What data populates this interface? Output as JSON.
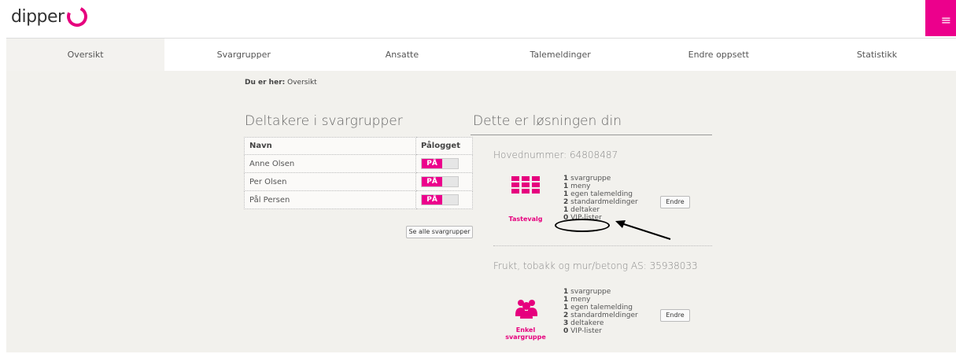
{
  "brand": {
    "name": "dipper",
    "accent": "#ec008c"
  },
  "header": {
    "menu_icon": "hamburger-icon"
  },
  "nav": {
    "tabs": [
      "Oversikt",
      "Svargrupper",
      "Ansatte",
      "Talemeldinger",
      "Endre oppsett",
      "Statistikk"
    ]
  },
  "breadcrumb": {
    "prefix": "Du er her:",
    "current": "Oversikt"
  },
  "members": {
    "title": "Deltakere i svargrupper",
    "columns": [
      "Navn",
      "Pålogget"
    ],
    "rows": [
      {
        "name": "Anne Olsen",
        "status": "PÅ"
      },
      {
        "name": "Per Olsen",
        "status": "PÅ"
      },
      {
        "name": "Pål Persen",
        "status": "PÅ"
      }
    ],
    "see_all_label": "Se alle svargrupper"
  },
  "solution": {
    "title": "Dette er løsningen din",
    "blocks": [
      {
        "title": "Hovednummer: 64808487",
        "icon_label": "Tastevalg",
        "icon": "keypad-icon",
        "lines": [
          {
            "count": "1",
            "label": "svargruppe"
          },
          {
            "count": "1",
            "label": "meny"
          },
          {
            "count": "1",
            "label": "egen talemelding"
          },
          {
            "count": "2",
            "label": "standardmeldinger"
          },
          {
            "count": "1",
            "label": "deltaker"
          },
          {
            "count": "0",
            "label": "VIP-lister"
          }
        ],
        "edit_label": "Endre"
      },
      {
        "title": "Frukt, tobakk og mur/betong AS: 35938033",
        "icon_label": "Enkel svargruppe",
        "icon": "group-icon",
        "lines": [
          {
            "count": "1",
            "label": "svargruppe"
          },
          {
            "count": "1",
            "label": "meny"
          },
          {
            "count": "1",
            "label": "egen talemelding"
          },
          {
            "count": "2",
            "label": "standardmeldinger"
          },
          {
            "count": "3",
            "label": "deltakere"
          },
          {
            "count": "0",
            "label": "VIP-lister"
          }
        ],
        "edit_label": "Endre"
      }
    ]
  }
}
